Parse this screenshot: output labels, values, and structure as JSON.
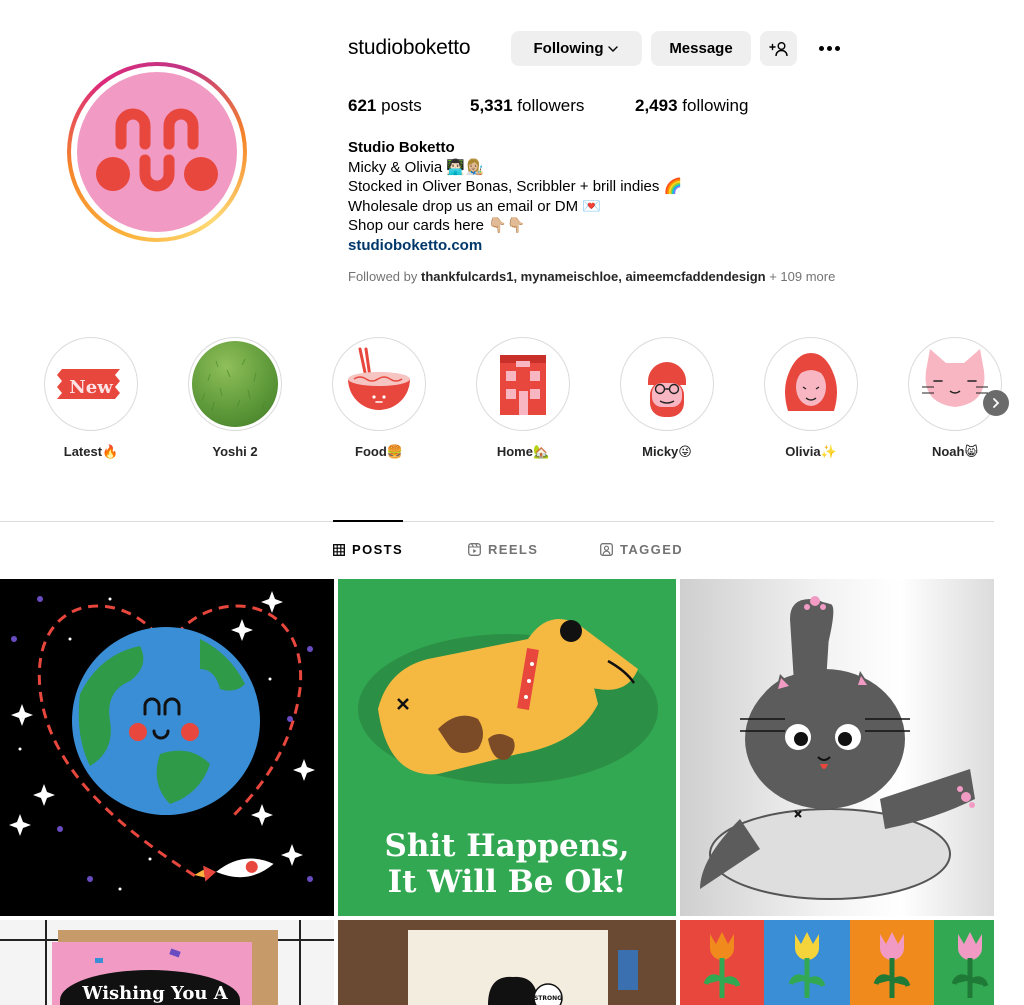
{
  "profile": {
    "username": "studioboketto",
    "following_label": "Following",
    "message_label": "Message",
    "posts_count": "621",
    "posts_label": "posts",
    "followers_count": "5,331",
    "followers_label": "followers",
    "following_count": "2,493",
    "following_stat_label": "following",
    "bio": {
      "name": "Studio Boketto",
      "line1": "Micky & Olivia 👨🏻‍💻👩🏼‍🎨",
      "line2": "Stocked in Oliver Bonas, Scribbler + brill indies 🌈",
      "line3": "Wholesale drop us an email or DM 💌",
      "line4": "Shop our cards here 👇🏼👇🏼",
      "link": "studioboketto.com"
    },
    "followed_by": {
      "prefix": "Followed by ",
      "names": "thankfulcards1, mynameischloe, aimeemcfaddendesign",
      "suffix": " + 109 more"
    }
  },
  "highlights": [
    {
      "label": "Latest🔥",
      "badge": "New"
    },
    {
      "label": "Yoshi 2"
    },
    {
      "label": "Food🍔"
    },
    {
      "label": "Home🏡"
    },
    {
      "label": "Micky😜"
    },
    {
      "label": "Olivia✨"
    },
    {
      "label": "Noah😸"
    }
  ],
  "tabs": [
    {
      "label": "POSTS",
      "active": true
    },
    {
      "label": "REELS",
      "active": false
    },
    {
      "label": "TAGGED",
      "active": false
    }
  ],
  "posts": {
    "p2_line1": "Shit Happens,",
    "p2_line2": "It Will Be Ok!",
    "p4_text": "Wishing You A",
    "p5_badge": "STRONG"
  },
  "colors": {
    "accent_link": "#00376b",
    "button_bg": "#efefef",
    "avatar_pink": "#f19bc4",
    "brand_red": "#e8473d",
    "post_green": "#33a852"
  },
  "icons": [
    "chevron-down-icon",
    "add-person-icon",
    "more-icon",
    "grid-icon",
    "reels-icon",
    "tagged-icon",
    "chevron-right-icon"
  ]
}
